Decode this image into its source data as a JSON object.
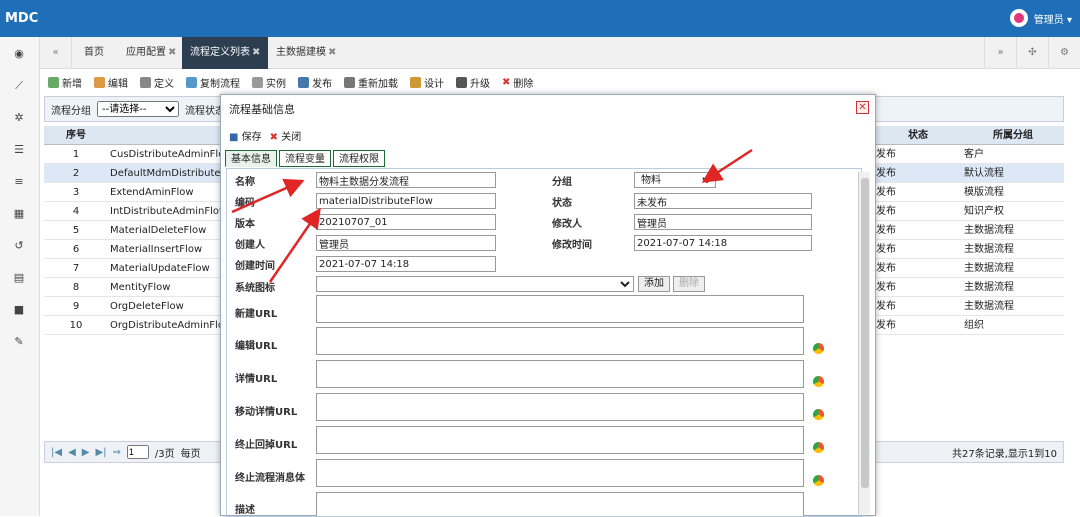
{
  "app": {
    "logo": "MDC",
    "user": "管理员 ▾"
  },
  "tabs": [
    {
      "label": "首页",
      "closable": false
    },
    {
      "label": "应用配置",
      "closable": true
    },
    {
      "label": "流程定义列表",
      "closable": true,
      "active": true
    },
    {
      "label": "主数据建模",
      "closable": true
    }
  ],
  "toolbar": {
    "add": "新增",
    "edit": "编辑",
    "define": "定义",
    "copy": "复制流程",
    "instance": "实例",
    "publish": "发布",
    "reload": "重新加载",
    "design": "设计",
    "upgrade": "升级",
    "delete": "删除"
  },
  "filter": {
    "group_label": "流程分组",
    "group_value": "--请选择--",
    "status_label": "流程状态"
  },
  "grid": {
    "headers": {
      "seq": "序号",
      "status": "状态",
      "group": "所属分组"
    },
    "rows": [
      {
        "seq": "1",
        "name": "CusDistributeAdminFlow",
        "status": "发布",
        "group": "客户"
      },
      {
        "seq": "2",
        "name": "DefaultMdmDistributeA",
        "status": "发布",
        "group": "默认流程"
      },
      {
        "seq": "3",
        "name": "ExtendAminFlow",
        "status": "发布",
        "group": "模版流程"
      },
      {
        "seq": "4",
        "name": "IntDistributeAdminFlow",
        "status": "发布",
        "group": "知识产权"
      },
      {
        "seq": "5",
        "name": "MaterialDeleteFlow",
        "status": "发布",
        "group": "主数据流程"
      },
      {
        "seq": "6",
        "name": "MaterialInsertFlow",
        "status": "发布",
        "group": "主数据流程"
      },
      {
        "seq": "7",
        "name": "MaterialUpdateFlow",
        "status": "发布",
        "group": "主数据流程"
      },
      {
        "seq": "8",
        "name": "MentityFlow",
        "status": "发布",
        "group": "主数据流程"
      },
      {
        "seq": "9",
        "name": "OrgDeleteFlow",
        "status": "发布",
        "group": "主数据流程"
      },
      {
        "seq": "10",
        "name": "OrgDistributeAdminFlow",
        "status": "发布",
        "group": "组织"
      }
    ]
  },
  "pager": {
    "page": "1",
    "pages": "/3页",
    "perpage": "每页",
    "total": "共27条记录,显示1到10"
  },
  "dialog": {
    "title": "流程基础信息",
    "save": "保存",
    "close": "关闭",
    "tabs": [
      "基本信息",
      "流程变量",
      "流程权限"
    ],
    "fields": {
      "name_label": "名称",
      "name_value": "物料主数据分发流程",
      "group_label": "分组",
      "group_value": "物料",
      "code_label": "编码",
      "code_value": "materialDistributeFlow",
      "state_label": "状态",
      "state_value": "未发布",
      "version_label": "版本",
      "version_value": "20210707_01",
      "modifier_label": "修改人",
      "modifier_value": "管理员",
      "creator_label": "创建人",
      "creator_value": "管理员",
      "modtime_label": "修改时间",
      "modtime_value": "2021-07-07 14:18",
      "ctime_label": "创建时间",
      "ctime_value": "2021-07-07 14:18",
      "icon_label": "系统图标",
      "add_btn": "添加",
      "del_btn": "删除",
      "new_url": "新建URL",
      "edit_url": "编辑URL",
      "detail_url": "详情URL",
      "mobile_url": "移动详情URL",
      "stop_url": "终止回掉URL",
      "stop_msg": "终止流程消息体",
      "desc": "描述"
    }
  }
}
